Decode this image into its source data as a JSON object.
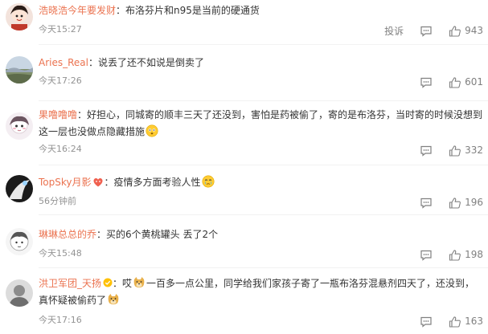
{
  "actions": {
    "report_label": "投诉"
  },
  "comments": [
    {
      "username": "浩晓浩今年要发财",
      "colon": "：",
      "text": "布洛芬片和n95是当前的硬通货",
      "time": "今天15:27",
      "likes": "943"
    },
    {
      "username": "Aries_Real",
      "colon": "：",
      "text": "说丢了还不如说是倒卖了",
      "time": "今天17:26",
      "likes": "601"
    },
    {
      "username": "果噜噜噜",
      "colon": "：",
      "text": "好担心，同城寄的顺丰三天了还没到，害怕是药被偷了，寄的是布洛芬，当时寄的时候没想到这一层也没做点隐藏措施",
      "time": "今天16:24",
      "likes": "332"
    },
    {
      "username": "TopSky月影",
      "colon": "：",
      "text": "疫情多方面考验人性",
      "time": "56分钟前",
      "likes": "196"
    },
    {
      "username": "琳琳总总的乔",
      "colon": "：",
      "text": "买的6个黄桃罐头 丢了2个",
      "time": "今天15:48",
      "likes": "198"
    },
    {
      "username": "洪卫军团_天扬",
      "colon": "：",
      "text_before": "哎",
      "text_after": "一百多一点公里，同学给我们家孩子寄了一瓶布洛芬混悬剂四天了，还没到，真怀疑被偷药了",
      "time": "今天17:16",
      "likes": "163"
    }
  ]
}
